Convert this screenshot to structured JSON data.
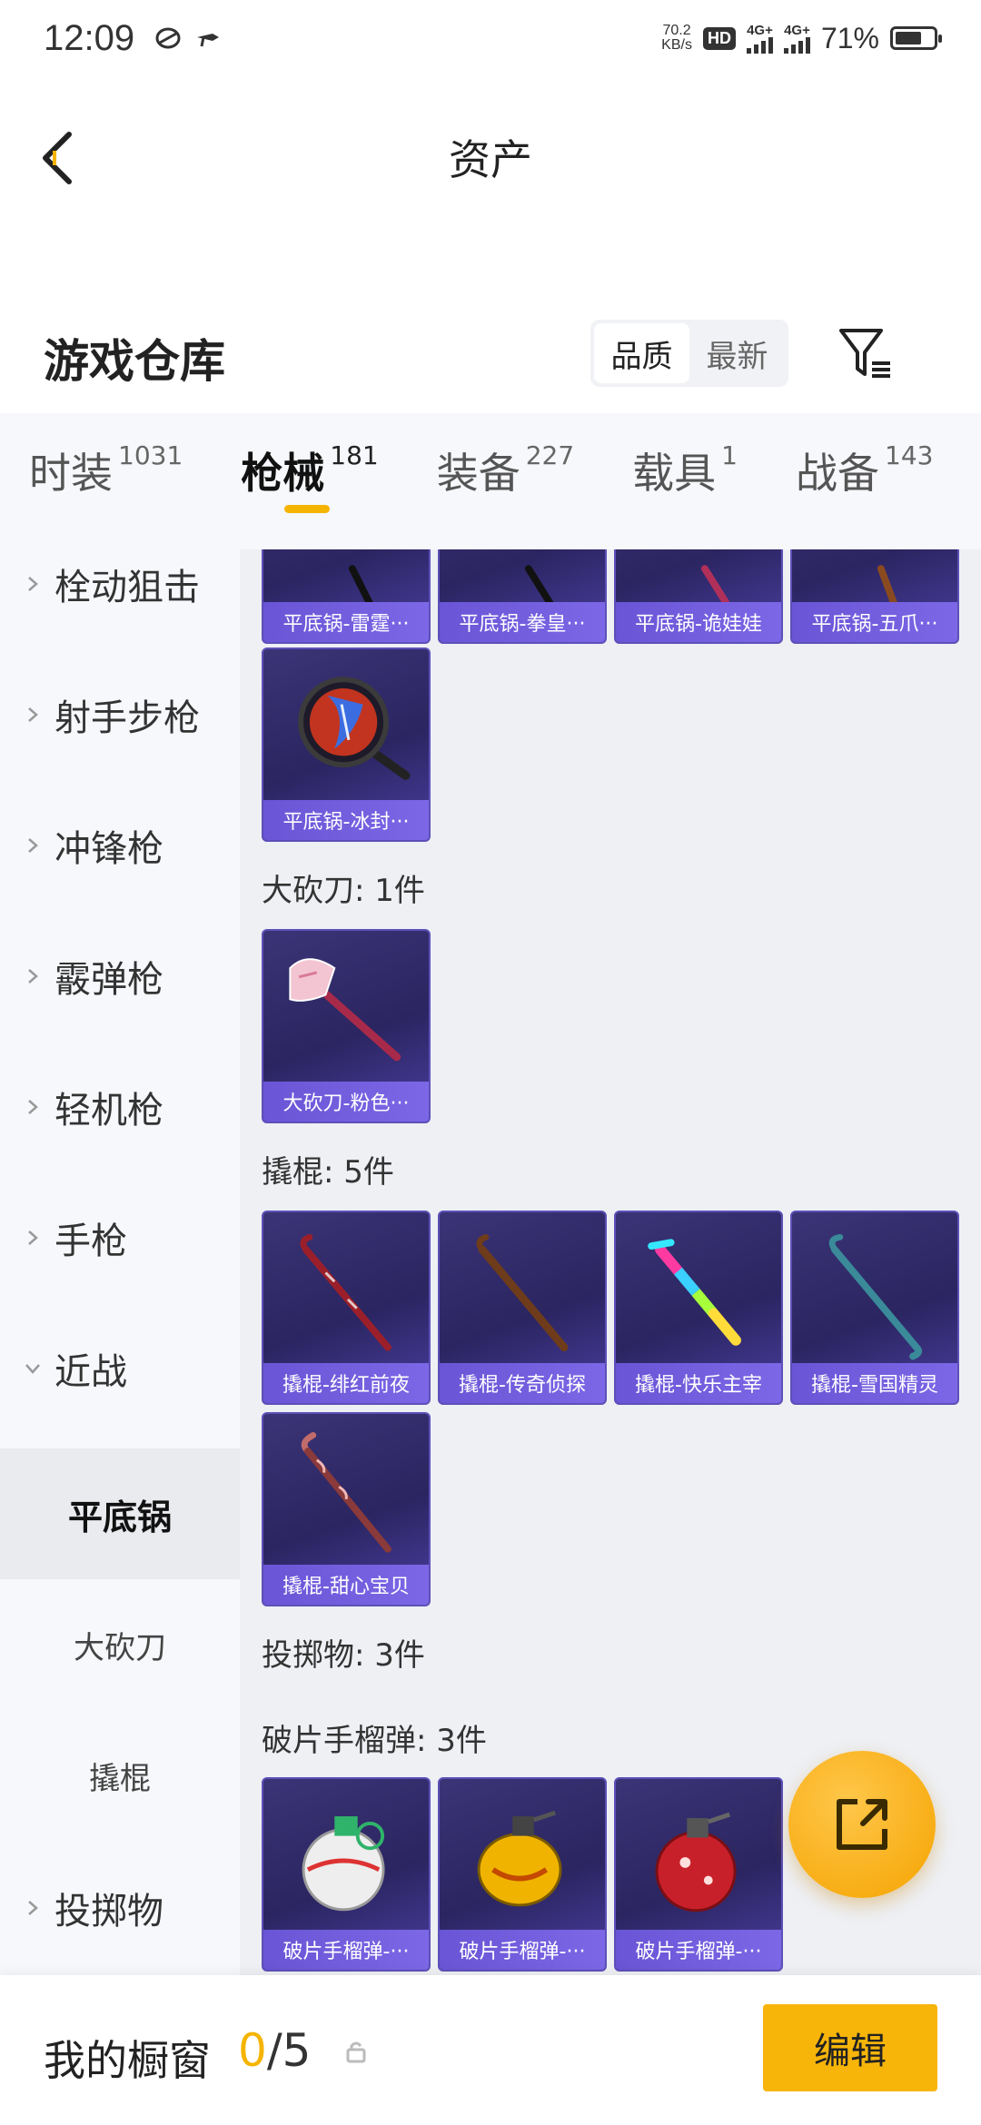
{
  "status_bar": {
    "time": "12:09",
    "net_speed_value": "70.2",
    "net_speed_unit": "KB/s",
    "hd": "HD",
    "sim1": "4G+",
    "sim2": "4G+",
    "battery_pct": "71%",
    "battery_level": 0.71
  },
  "header": {
    "title": "资产"
  },
  "warehouse": {
    "title": "游戏仓库",
    "sort_quality": "品质",
    "sort_newest": "最新"
  },
  "categories": [
    {
      "label": "时装",
      "count": "1031"
    },
    {
      "label": "枪械",
      "count": "181"
    },
    {
      "label": "装备",
      "count": "227"
    },
    {
      "label": "载具",
      "count": "1"
    },
    {
      "label": "战备",
      "count": "143"
    }
  ],
  "sidebar": {
    "items": [
      {
        "label": "栓动狙击"
      },
      {
        "label": "射手步枪"
      },
      {
        "label": "冲锋枪"
      },
      {
        "label": "霰弹枪"
      },
      {
        "label": "轻机枪"
      },
      {
        "label": "手枪"
      },
      {
        "label": "近战"
      }
    ],
    "subitems": [
      {
        "label": "平底锅"
      },
      {
        "label": "大砍刀"
      },
      {
        "label": "撬棍"
      }
    ],
    "last_item": {
      "label": "投掷物"
    }
  },
  "main": {
    "pans_top_row": [
      {
        "name": "平底锅-雷霆···"
      },
      {
        "name": "平底锅-拳皇···"
      },
      {
        "name": "平底锅-诡娃娃"
      },
      {
        "name": "平底锅-五爪···"
      }
    ],
    "pan_single": {
      "name": "平底锅-冰封···"
    },
    "machete_section": "大砍刀: 1件",
    "machete": {
      "name": "大砍刀-粉色···"
    },
    "crowbar_section": "撬棍: 5件",
    "crowbars": [
      {
        "name": "撬棍-绯红前夜"
      },
      {
        "name": "撬棍-传奇侦探"
      },
      {
        "name": "撬棍-快乐主宰"
      },
      {
        "name": "撬棍-雪国精灵"
      },
      {
        "name": "撬棍-甜心宝贝"
      }
    ],
    "throwables_section": "投掷物: 3件",
    "grenade_section": "破片手榴弹: 3件",
    "grenades": [
      {
        "name": "破片手榴弹-···"
      },
      {
        "name": "破片手榴弹-···"
      },
      {
        "name": "破片手榴弹-···"
      }
    ]
  },
  "bottom": {
    "showcase_label": "我的橱窗",
    "showcase_current": "0",
    "showcase_total": "/5",
    "edit_label": "编辑"
  },
  "colors": {
    "accent": "#f5b400",
    "card_bg": "#2b2561",
    "card_caption": "#6a55d6"
  }
}
